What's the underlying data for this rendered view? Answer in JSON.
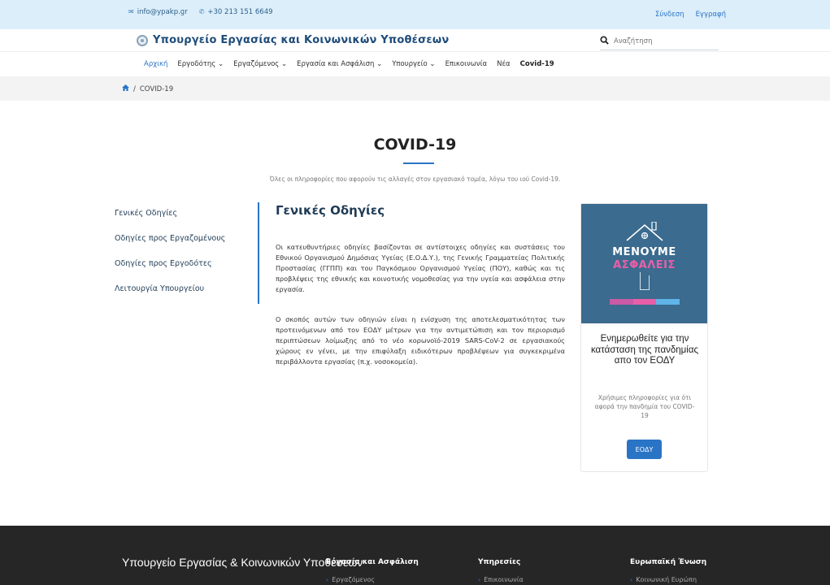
{
  "topbar": {
    "email": "info@ypakp.gr",
    "phone": "+30 213 151 6649",
    "login": "Σύνδεση",
    "register": "Εγγραφή"
  },
  "brand": {
    "name": "Υπουργείο Εργασίας και Κοινωνικών Υποθέσεων"
  },
  "search": {
    "placeholder": "Αναζήτηση"
  },
  "nav": {
    "items": [
      {
        "label": "Αρχική"
      },
      {
        "label": "Εργοδότης ⌄"
      },
      {
        "label": "Εργαζόμενος ⌄"
      },
      {
        "label": "Εργασία και Ασφάλιση ⌄"
      },
      {
        "label": "Υπουργείο ⌄"
      },
      {
        "label": "Επικοινωνία"
      },
      {
        "label": "Νέα"
      },
      {
        "label": "Covid-19"
      }
    ]
  },
  "breadcrumb": {
    "separator": "/",
    "current": "COVID-19"
  },
  "page": {
    "title": "COVID-19",
    "subtitle": "Όλες οι πληροφορίες που αφορούν τις αλλαγές στον εργασιακό τομέα, λόγω του ιού Covid-19."
  },
  "sidenav": {
    "items": [
      {
        "label": "Γενικές Οδηγίες"
      },
      {
        "label": "Οδηγίες προς Εργαζομένους"
      },
      {
        "label": "Οδηγίες προς Εργοδότες"
      },
      {
        "label": "Λειτουργία Υπουργείου"
      }
    ]
  },
  "article": {
    "heading": "Γενικές Οδηγίες",
    "paragraphs": [
      "Οι κατευθυντήριες οδηγίες βασίζονται σε αντίστοιχες οδηγίες και συστάσεις του Εθνικού Οργανισμού Δημόσιας Υγείας (Ε.Ο.Δ.Υ.), της Γενικής Γραμματείας Πολιτικής Προστασίας (ΓΓΠΠ) και του Παγκόσμιου Οργανισμού Υγείας (ΠΟΥ), καθώς και τις προβλέψεις της εθνικής και κοινοτικής νομοθεσίας για την υγεία και ασφάλεια στην εργασία.",
      "Ο σκοπός αυτών των οδηγιών είναι η ενίσχυση της αποτελεσματικότητας των προτεινόμενων από τον ΕΟΔΥ μέτρων για την αντιμετώπιση και τον περιορισμό περιπτώσεων λοίμωξης από το νέο κορωνοϊό-2019 SARS-CoV-2 σε εργασιακούς χώρους εν γένει, με την επιφύλαξη ειδικότερων προβλέψεων για συγκεκριμένα περιβάλλοντα εργασίας (π.χ. νοσοκομεία)."
    ]
  },
  "card": {
    "banner_line1": "ΜΕΝΟΥΜΕ",
    "banner_line2": "ΑΣΦΑΛΕΙΣ",
    "title": "Ενημερωθείτε για την κατάσταση της πανδημίας απο τον ΕΟΔΥ",
    "description": "Χρήσιμες πληροφορίες για ότι αφορά την πανδημία του COVID-19",
    "button": "ΕΟΔΥ",
    "colors": {
      "banner": "#3b6b8e",
      "accent": "#e85fa8",
      "button": "#2a74c6"
    }
  },
  "footer": {
    "brand": "Υπουργείο Εργασίας & Κοινωνικών Υποθέσεων",
    "columns": [
      {
        "title": "Εργασία και Ασφάλιση",
        "first_item": "Εργαζόμενος"
      },
      {
        "title": "Υπηρεσίες",
        "first_item": "Επικοινωνία"
      },
      {
        "title": "Ευρωπαϊκή Ένωση",
        "first_item": "Κοινωνική Ευρώπη"
      }
    ]
  }
}
